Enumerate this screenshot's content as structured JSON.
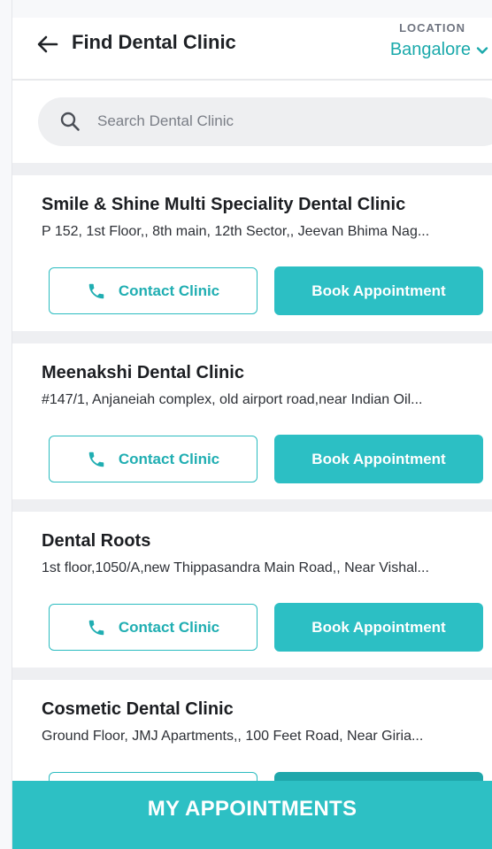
{
  "header": {
    "title": "Find Dental Clinic",
    "location_label": "LOCATION",
    "location_value": "Bangalore"
  },
  "search": {
    "placeholder": "Search Dental Clinic"
  },
  "clinics": [
    {
      "name": "Smile & Shine Multi Speciality Dental Clinic",
      "address": "P 152, 1st Floor,, 8th main, 12th Sector,, Jeevan Bhima Nag..."
    },
    {
      "name": "Meenakshi Dental Clinic",
      "address": "#147/1, Anjaneiah complex, old airport road,near Indian Oil..."
    },
    {
      "name": "Dental Roots",
      "address": "1st floor,1050/A,new Thippasandra Main Road,, Near Vishal..."
    },
    {
      "name": "Cosmetic Dental Clinic",
      "address": "Ground Floor, JMJ Apartments,, 100 Feet Road, Near Giria..."
    }
  ],
  "buttons": {
    "contact_label": "Contact Clinic",
    "book_label": "Book Appointment"
  },
  "bottom_bar": {
    "label": "MY APPOINTMENTS"
  },
  "icons": {
    "back": "back-arrow-icon",
    "location_dropdown": "chevron-down-icon",
    "search": "search-icon",
    "phone": "phone-icon"
  },
  "colors": {
    "accent": "#2cbfc4",
    "accent_text": "#1aa9ab",
    "text_dark": "#1c1e22"
  }
}
